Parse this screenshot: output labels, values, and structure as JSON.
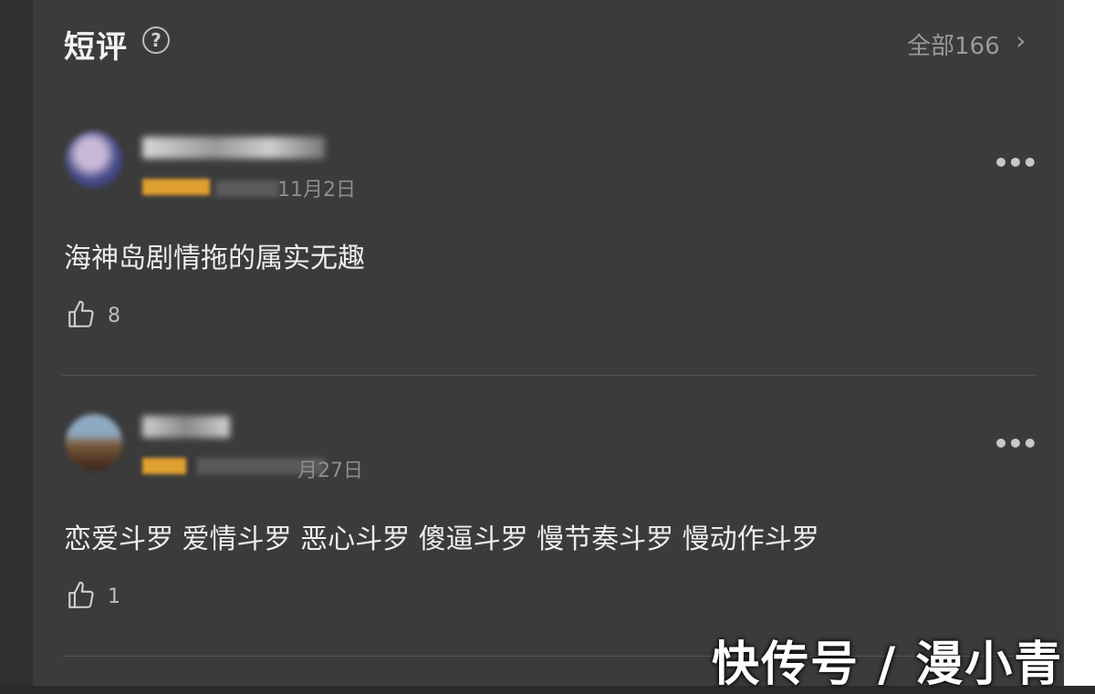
{
  "header": {
    "title": "短评",
    "help_symbol": "?",
    "all_link": "全部166",
    "chevron": "›"
  },
  "comments": [
    {
      "date": "11月2日",
      "text": "海神岛剧情拖的属实无趣",
      "likes": "8",
      "more": "•••"
    },
    {
      "date": "月27日",
      "text": "恋爱斗罗 爱情斗罗 恶心斗罗 傻逼斗罗 慢节奏斗罗 慢动作斗罗",
      "likes": "1",
      "more": "•••"
    }
  ],
  "watermark": "快传号 / 漫小青",
  "colors": {
    "panel": "#3b3b3b",
    "text": "#ededed",
    "muted": "#8e8e8e",
    "level_badge": "#e0a030"
  }
}
